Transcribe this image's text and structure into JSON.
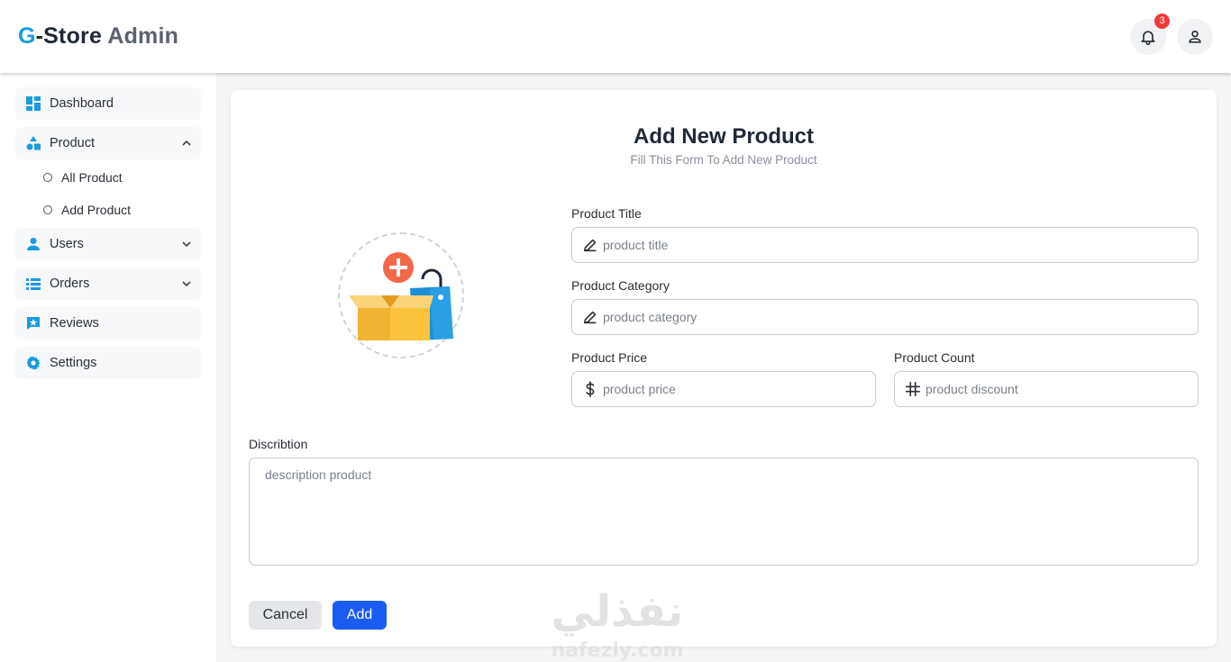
{
  "app": {
    "logo_g": "G",
    "logo_store": "-Store",
    "logo_admin": "Admin",
    "notification_count": "3"
  },
  "sidebar": {
    "items": [
      {
        "label": "Dashboard",
        "icon": "dashboard-icon"
      },
      {
        "label": "Product",
        "icon": "shapes-icon",
        "expanded": true,
        "children": [
          {
            "label": "All Product"
          },
          {
            "label": "Add Product"
          }
        ]
      },
      {
        "label": "Users",
        "icon": "user-icon"
      },
      {
        "label": "Orders",
        "icon": "list-icon"
      },
      {
        "label": "Reviews",
        "icon": "review-icon"
      },
      {
        "label": "Settings",
        "icon": "gear-icon"
      }
    ]
  },
  "form": {
    "title": "Add New Product",
    "subtitle": "Fill This Form To Add New Product",
    "product_title": {
      "label": "Product Title",
      "placeholder": "product title"
    },
    "product_category": {
      "label": "Product Category",
      "placeholder": "product category"
    },
    "product_price": {
      "label": "Product Price",
      "placeholder": "product price"
    },
    "product_count": {
      "label": "Product Count",
      "placeholder": "product discount"
    },
    "description": {
      "label": "Discribtion",
      "placeholder": "description product"
    },
    "cancel_label": "Cancel",
    "add_label": "Add"
  },
  "watermark": {
    "arabic": "نفذلي",
    "latin": "nafezly.com"
  },
  "colors": {
    "accent_blue": "#1a9be0",
    "primary_button": "#1a5cf2",
    "badge_red": "#ef3b3b",
    "icon_blue": "#1a9be0"
  }
}
